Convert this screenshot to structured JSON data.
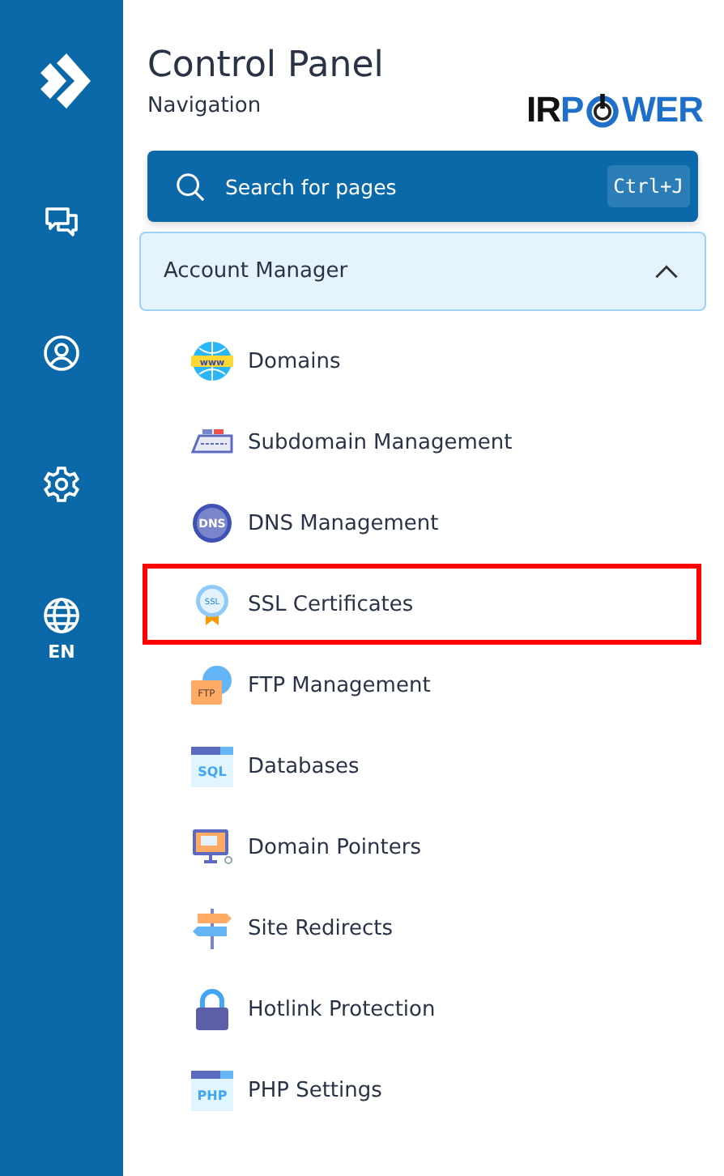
{
  "rail": {
    "language": "EN"
  },
  "header": {
    "title": "Control Panel",
    "subtitle": "Navigation",
    "logo": {
      "start": "IRP",
      "end": "WER"
    }
  },
  "search": {
    "placeholder": "Search for pages",
    "shortcut": "Ctrl+J"
  },
  "section": {
    "title": "Account Manager",
    "expanded": true,
    "items": [
      {
        "label": "Domains",
        "kind": "globe",
        "icon_text": "www",
        "highlighted": false
      },
      {
        "label": "Subdomain Management",
        "kind": "server",
        "highlighted": false
      },
      {
        "label": "DNS Management",
        "kind": "dns",
        "icon_text": "DNS",
        "highlighted": false
      },
      {
        "label": "SSL Certificates",
        "kind": "badge",
        "icon_text": "SSL",
        "highlighted": true
      },
      {
        "label": "FTP Management",
        "kind": "folder",
        "icon_text": "FTP",
        "highlighted": false
      },
      {
        "label": "Databases",
        "kind": "window",
        "icon_text": "SQL",
        "highlighted": false
      },
      {
        "label": "Domain Pointers",
        "kind": "monitor",
        "highlighted": false
      },
      {
        "label": "Site Redirects",
        "kind": "signpost",
        "highlighted": false
      },
      {
        "label": "Hotlink Protection",
        "kind": "lock",
        "highlighted": false
      },
      {
        "label": "PHP Settings",
        "kind": "window",
        "icon_text": "PHP",
        "highlighted": false
      }
    ]
  }
}
